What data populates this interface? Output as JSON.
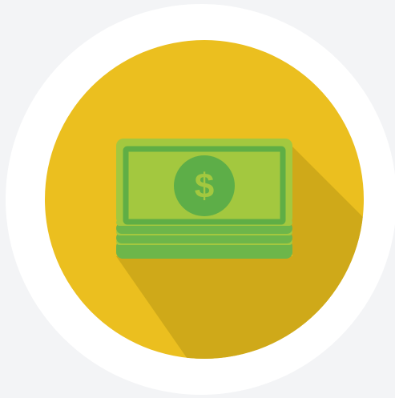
{
  "icon": {
    "name": "money-stack-icon",
    "symbol": "$",
    "colors": {
      "background": "#f3f4f6",
      "outer_ring": "#ffffff",
      "circle": "#ebbf1f",
      "long_shadow": "#cfa919",
      "bill_base": "#6db64a",
      "bill_light": "#a3c83f",
      "bill_frame": "#5fae45",
      "coin": "#5dae48",
      "symbol": "#a3c83f"
    }
  }
}
